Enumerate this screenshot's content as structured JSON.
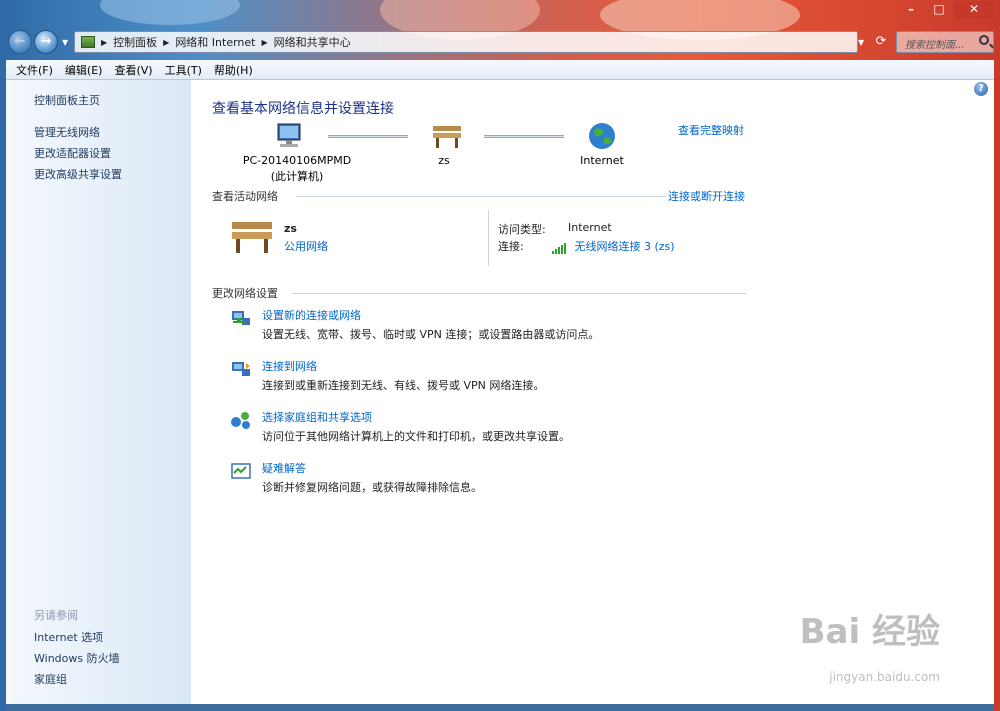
{
  "window": {
    "minimize_icon": "minimize-icon",
    "maximize_icon": "maximize-icon",
    "close_icon": "close-icon"
  },
  "address": {
    "breadcrumbs": [
      "控制面板",
      "网络和 Internet",
      "网络和共享中心"
    ],
    "search_placeholder": "搜索控制面..."
  },
  "menu": [
    "文件(F)",
    "编辑(E)",
    "查看(V)",
    "工具(T)",
    "帮助(H)"
  ],
  "sidebar": {
    "home": "控制面板主页",
    "links": [
      "管理无线网络",
      "更改适配器设置",
      "更改高级共享设置"
    ],
    "see_also_heading": "另请参阅",
    "see_also": [
      "Internet 选项",
      "Windows 防火墙",
      "家庭组"
    ]
  },
  "main": {
    "title": "查看基本网络信息并设置连接",
    "full_map_link": "查看完整映射",
    "nodes": {
      "computer_name": "PC-20140106MPMD",
      "computer_sub": "(此计算机)",
      "network": "zs",
      "internet": "Internet"
    },
    "active_networks_label": "查看活动网络",
    "connect_disconnect_link": "连接或断开连接",
    "active_network": {
      "name": "zs",
      "type_link": "公用网络",
      "access_type_label": "访问类型:",
      "access_type_value": "Internet",
      "connection_label": "连接:",
      "connection_value": "无线网络连接 3 (zs)"
    },
    "change_settings_label": "更改网络设置",
    "tasks": [
      {
        "title": "设置新的连接或网络",
        "desc": "设置无线、宽带、拨号、临时或 VPN 连接；或设置路由器或访问点。"
      },
      {
        "title": "连接到网络",
        "desc": "连接到或重新连接到无线、有线、拨号或 VPN 网络连接。"
      },
      {
        "title": "选择家庭组和共享选项",
        "desc": "访问位于其他网络计算机上的文件和打印机，或更改共享设置。"
      },
      {
        "title": "疑难解答",
        "desc": "诊断并修复网络问题，或获得故障排除信息。"
      }
    ]
  },
  "watermark": {
    "brand": "Bai 经验",
    "url": "jingyan.baidu.com"
  },
  "colors": {
    "link": "#0066cc",
    "title": "#1e3287",
    "sidebar_link": "#1e395b"
  }
}
